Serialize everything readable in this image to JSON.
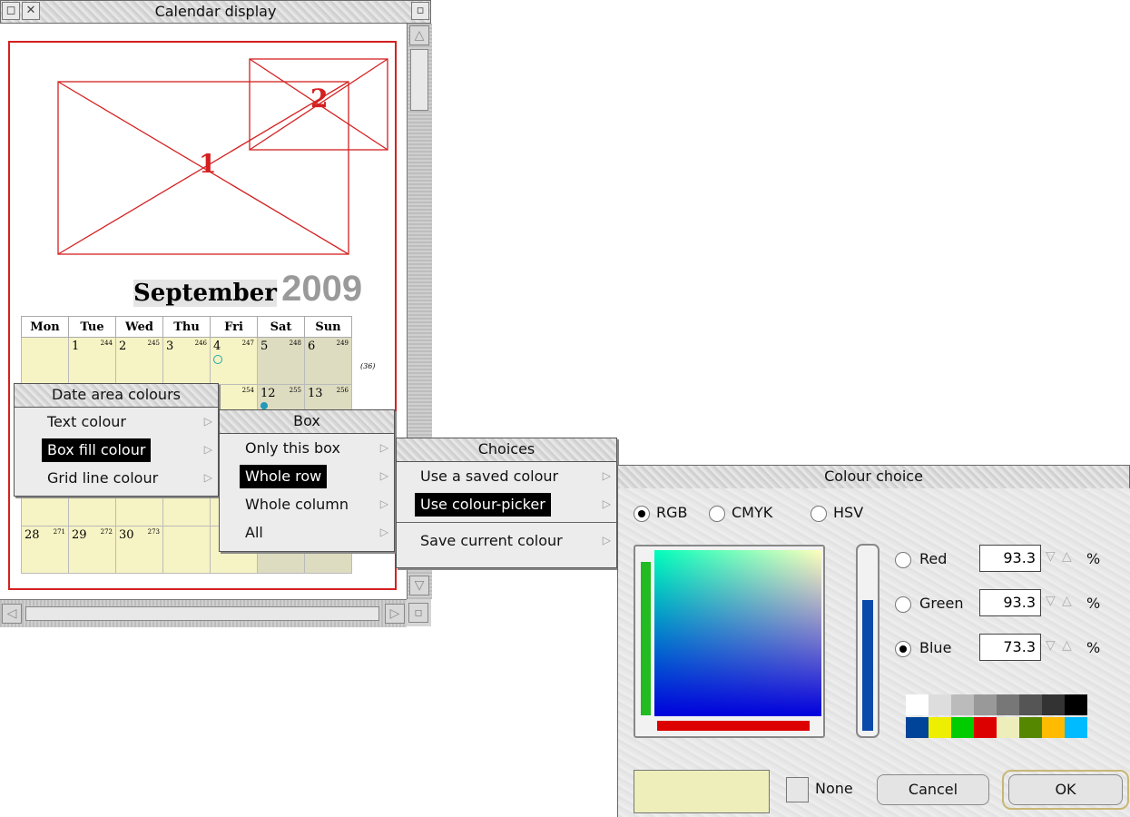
{
  "calendar_window": {
    "title": "Calendar display",
    "month": "September",
    "year": "2009",
    "box1_label": "1",
    "box2_label": "2",
    "days_header": [
      "Mon",
      "Tue",
      "Wed",
      "Thu",
      "Fri",
      "Sat",
      "Sun"
    ],
    "weeks": [
      [
        {
          "d": "",
          "n": ""
        },
        {
          "d": "1",
          "n": "244"
        },
        {
          "d": "2",
          "n": "245"
        },
        {
          "d": "3",
          "n": "246"
        },
        {
          "d": "4",
          "n": "247"
        },
        {
          "d": "5",
          "n": "248"
        },
        {
          "d": "6",
          "n": "249"
        }
      ],
      [
        {
          "d": "",
          "n": ""
        },
        {
          "d": "",
          "n": ""
        },
        {
          "d": "",
          "n": ""
        },
        {
          "d": "",
          "n": ""
        },
        {
          "d": "1",
          "n": "254"
        },
        {
          "d": "12",
          "n": "255"
        },
        {
          "d": "13",
          "n": "256"
        }
      ],
      [
        {
          "d": "",
          "n": ""
        },
        {
          "d": "",
          "n": ""
        },
        {
          "d": "",
          "n": ""
        },
        {
          "d": "",
          "n": ""
        },
        {
          "d": "",
          "n": ""
        },
        {
          "d": "",
          "n": ""
        },
        {
          "d": "",
          "n": ""
        }
      ],
      [
        {
          "d": "",
          "n": ""
        },
        {
          "d": "",
          "n": ""
        },
        {
          "d": "",
          "n": ""
        },
        {
          "d": "",
          "n": ""
        },
        {
          "d": "",
          "n": ""
        },
        {
          "d": "",
          "n": ""
        },
        {
          "d": "",
          "n": ""
        }
      ],
      [
        {
          "d": "28",
          "n": "271"
        },
        {
          "d": "29",
          "n": "272"
        },
        {
          "d": "30",
          "n": "273"
        },
        {
          "d": "",
          "n": ""
        },
        {
          "d": "",
          "n": ""
        },
        {
          "d": "",
          "n": ""
        },
        {
          "d": "",
          "n": ""
        }
      ]
    ],
    "week_label": "(36)"
  },
  "menu_date_area": {
    "title": "Date area colours",
    "items": [
      {
        "label": "Text colour",
        "selected": false
      },
      {
        "label": "Box fill colour",
        "selected": true
      },
      {
        "label": "Grid line colour",
        "selected": false
      }
    ]
  },
  "menu_box": {
    "title": "Box",
    "items": [
      {
        "label": "Only this box",
        "selected": false
      },
      {
        "label": "Whole row",
        "selected": true
      },
      {
        "label": "Whole column",
        "selected": false
      },
      {
        "label": "All",
        "selected": false
      }
    ]
  },
  "menu_choices": {
    "title": "Choices",
    "items": [
      {
        "label": "Use a saved colour",
        "selected": false
      },
      {
        "label": "Use colour-picker",
        "selected": true
      }
    ],
    "extra_item": "Save current colour"
  },
  "colour_picker": {
    "title": "Colour choice",
    "models": [
      {
        "label": "RGB",
        "checked": true
      },
      {
        "label": "CMYK",
        "checked": false
      },
      {
        "label": "HSV",
        "checked": false
      }
    ],
    "channels": [
      {
        "label": "Red",
        "value": "93.3",
        "unit": "%",
        "checked": false
      },
      {
        "label": "Green",
        "value": "93.3",
        "unit": "%",
        "checked": false
      },
      {
        "label": "Blue",
        "value": "73.3",
        "unit": "%",
        "checked": true
      }
    ],
    "palette": [
      "#ffffff",
      "#dddddd",
      "#bbbbbb",
      "#999999",
      "#777777",
      "#555555",
      "#333333",
      "#000000",
      "#004499",
      "#eeee00",
      "#00cc00",
      "#dd0000",
      "#eeeebb",
      "#558800",
      "#ffbb00",
      "#00bbff"
    ],
    "current_colour": "#eeeebb",
    "none_label": "None",
    "cancel_label": "Cancel",
    "ok_label": "OK"
  }
}
